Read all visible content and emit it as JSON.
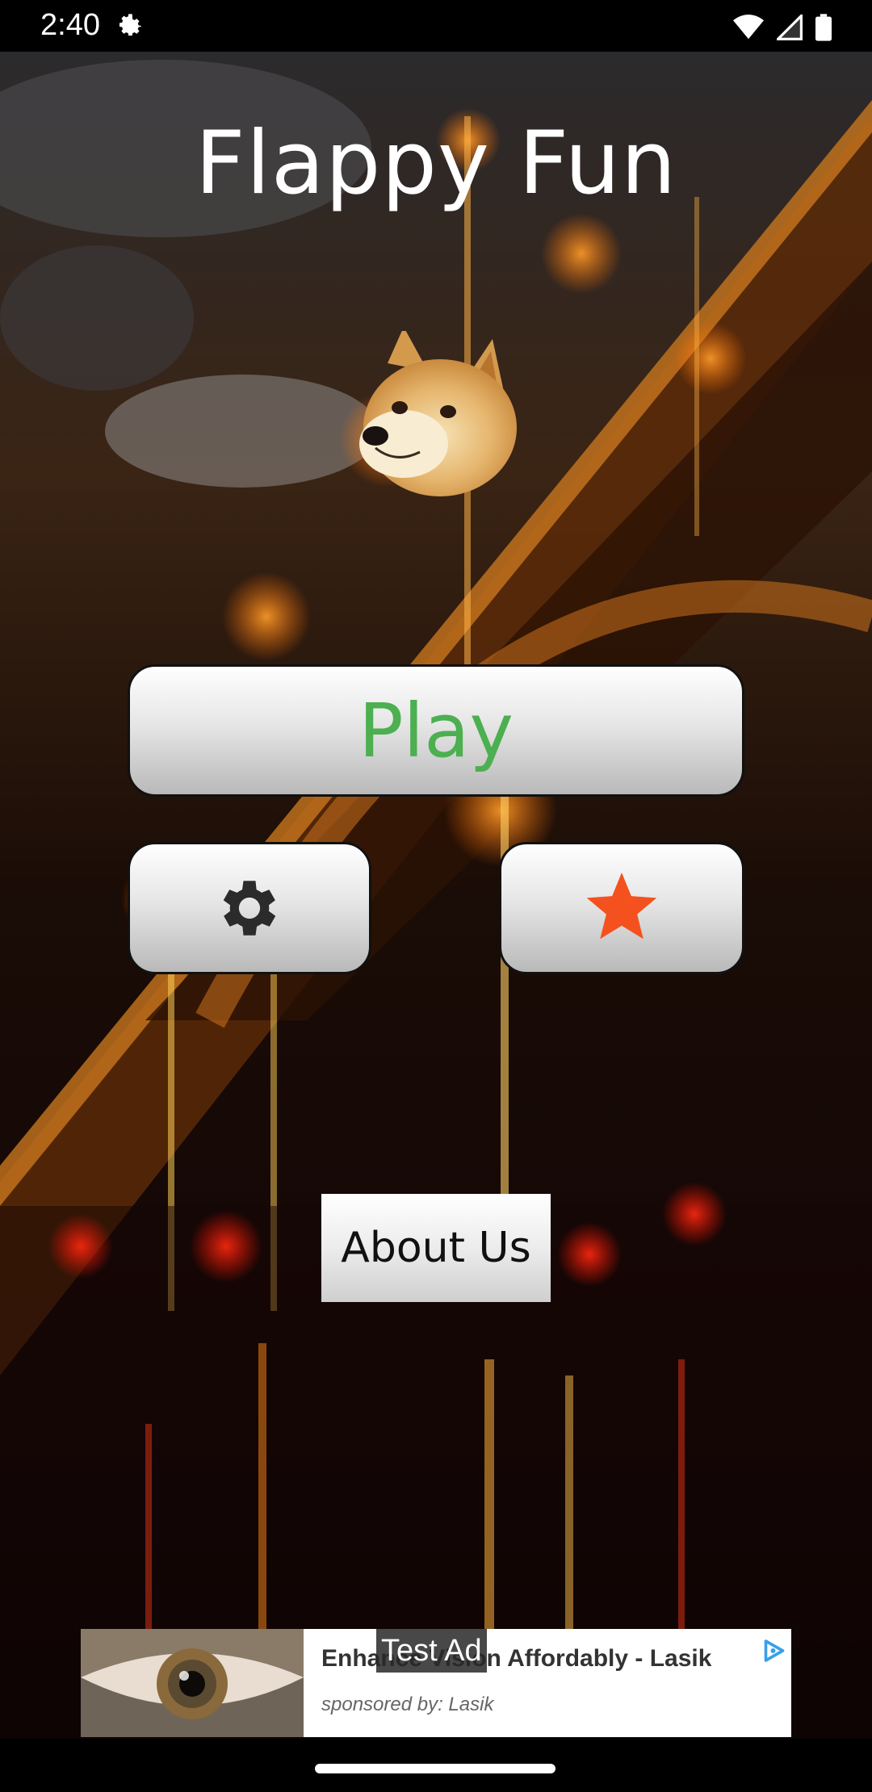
{
  "status_bar": {
    "time": "2:40",
    "icons": [
      "settings-gear-icon",
      "wifi-icon",
      "signal-icon",
      "battery-icon"
    ]
  },
  "app": {
    "title": "Flappy Fun",
    "mascot": "doge-icon"
  },
  "buttons": {
    "play_label": "Play",
    "play_color": "#4caf50",
    "settings_icon": "gear-icon",
    "rate_icon": "star-icon",
    "rate_color": "#f4511e",
    "about_label": "About Us"
  },
  "ad": {
    "badge": "Test Ad",
    "headline": "Enhance Vision Affordably - Lasik",
    "sponsor": "sponsored by: Lasik",
    "image": "eye-icon",
    "choices_icon": "ad-choices-icon"
  }
}
